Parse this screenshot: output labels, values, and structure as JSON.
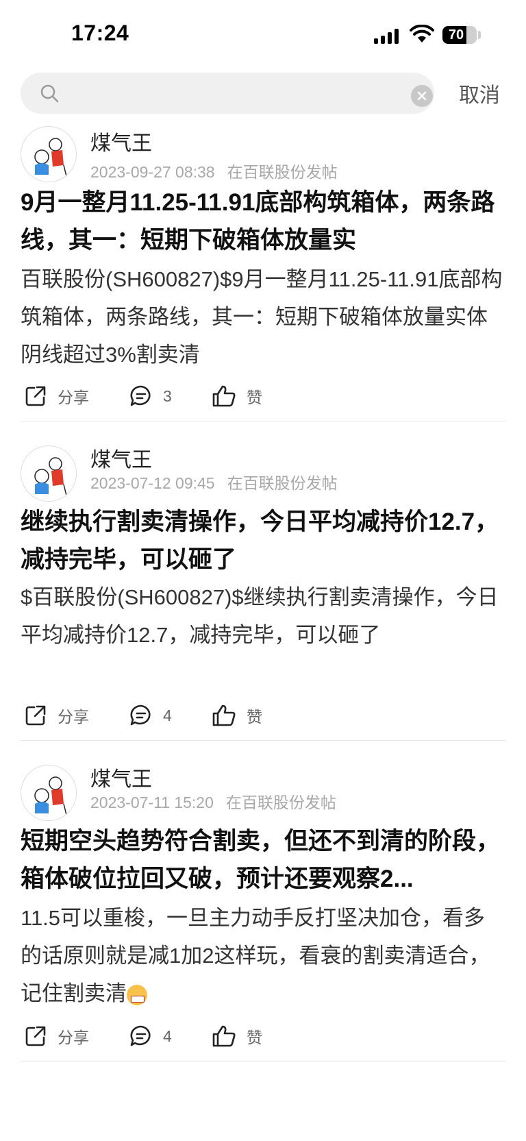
{
  "status_bar": {
    "time": "17:24",
    "battery": "70",
    "battery_level": 0.7
  },
  "search": {
    "value": "",
    "cancel_label": "取消"
  },
  "posts": [
    {
      "author": "煤气王",
      "timestamp": "2023-09-27 08:38",
      "location": "在百联股份发帖",
      "title": "9月一整月11.25-11.91底部构筑箱体，两条路线，其一：短期下破箱体放量实",
      "body": "百联股份(SH600827)$9月一整月11.25-11.91底部构筑箱体，两条路线，其一：短期下破箱体放量实体阴线超过3%割卖清",
      "share_label": "分享",
      "comment_count": "3",
      "like_label": "赞"
    },
    {
      "author": "煤气王",
      "timestamp": "2023-07-12 09:45",
      "location": "在百联股份发帖",
      "title": "继续执行割卖清操作，今日平均减持价12.7，减持完毕，可以砸了",
      "body": "$百联股份(SH600827)$继续执行割卖清操作，今日平均减持价12.7，减持完毕，可以砸了",
      "share_label": "分享",
      "comment_count": "4",
      "like_label": "赞"
    },
    {
      "author": "煤气王",
      "timestamp": "2023-07-11 15:20",
      "location": "在百联股份发帖",
      "title": "短期空头趋势符合割卖，但还不到清的阶段，箱体破位拉回又破，预计还要观察2...",
      "body": "11.5可以重梭，一旦主力动手反打坚决加仓，看多的话原则就是减1加2这样玩，看衰的割卖清适合，记住割卖清",
      "share_label": "分享",
      "comment_count": "4",
      "like_label": "赞"
    }
  ]
}
